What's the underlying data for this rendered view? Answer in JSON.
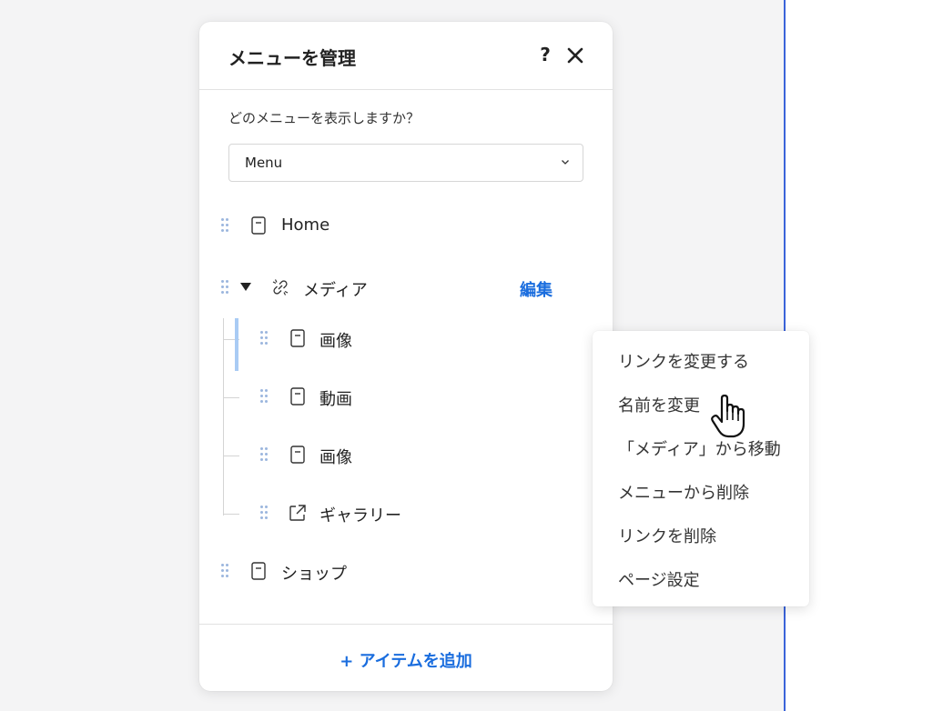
{
  "panel": {
    "title": "メニューを管理",
    "help_label": "?",
    "question": "どのメニューを表示しますか？",
    "menu_select": {
      "value": "Menu"
    },
    "items": [
      {
        "label": "Home",
        "icon": "page-icon"
      },
      {
        "label": "メディア",
        "icon": "link-broken-icon",
        "expanded": true,
        "action_label": "編集"
      },
      {
        "label": "画像",
        "icon": "page-icon"
      },
      {
        "label": "動画",
        "icon": "page-icon"
      },
      {
        "label": "画像",
        "icon": "page-icon"
      },
      {
        "label": "ギャラリー",
        "icon": "external-link-icon"
      },
      {
        "label": "ショップ",
        "icon": "page-icon"
      }
    ],
    "add_item_label": "+ アイテムを追加"
  },
  "context_menu": {
    "items": [
      "リンクを変更する",
      "名前を変更",
      "「メディア」から移動",
      "メニューから削除",
      "リンクを削除",
      "ページ設定"
    ]
  },
  "colors": {
    "accent": "#1a6dde",
    "drag_handle": "#9bb6de",
    "selection_bar": "#a9cbf4",
    "canvas_border": "#3a63d9"
  }
}
